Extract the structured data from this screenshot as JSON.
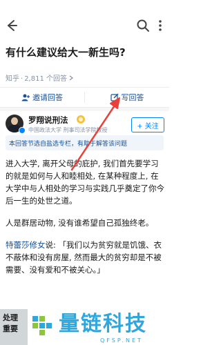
{
  "question": {
    "title": "有什么建议给大一新生吗?",
    "site": "知乎",
    "separator": "·",
    "answer_count": "2,811 个回答"
  },
  "actions": {
    "invite_label": "邀请回答",
    "write_label": "写回答"
  },
  "author": {
    "name": "罗翔说刑法",
    "description": "中国政法大学 刑事司法学院教授",
    "follow_label": "+ 关注"
  },
  "notice": "本回答节选自盐选专栏，有助于解答该问题",
  "answer": {
    "p1": "进入大学, 离开父母的庇护, 我们首先要学习的就是如何与人和睦相处, 在某种程度上, 在大学中与人相处的学习与实践几乎奠定了你今后一生的处世之道。",
    "p2": "人是群居动物, 没有谁希望自己孤独终老。",
    "p3_mention": "特蕾莎修女",
    "p3_rest": "说: 「我们以为贫穷就是饥饿、衣不蔽体和没有房屋, 然而最大的贫穷却是不被需要、没有爱和不被关心。」",
    "p4_partial": "处理"
  },
  "overlay_bottom": "重要",
  "watermark": {
    "text": "量链科技",
    "url": "QFSP.NET"
  },
  "colors": {
    "link_blue": "#175199",
    "brand_blue": "#0084ff",
    "arrow_red": "#e8413b",
    "watermark_blue": "#2fa7dc"
  }
}
